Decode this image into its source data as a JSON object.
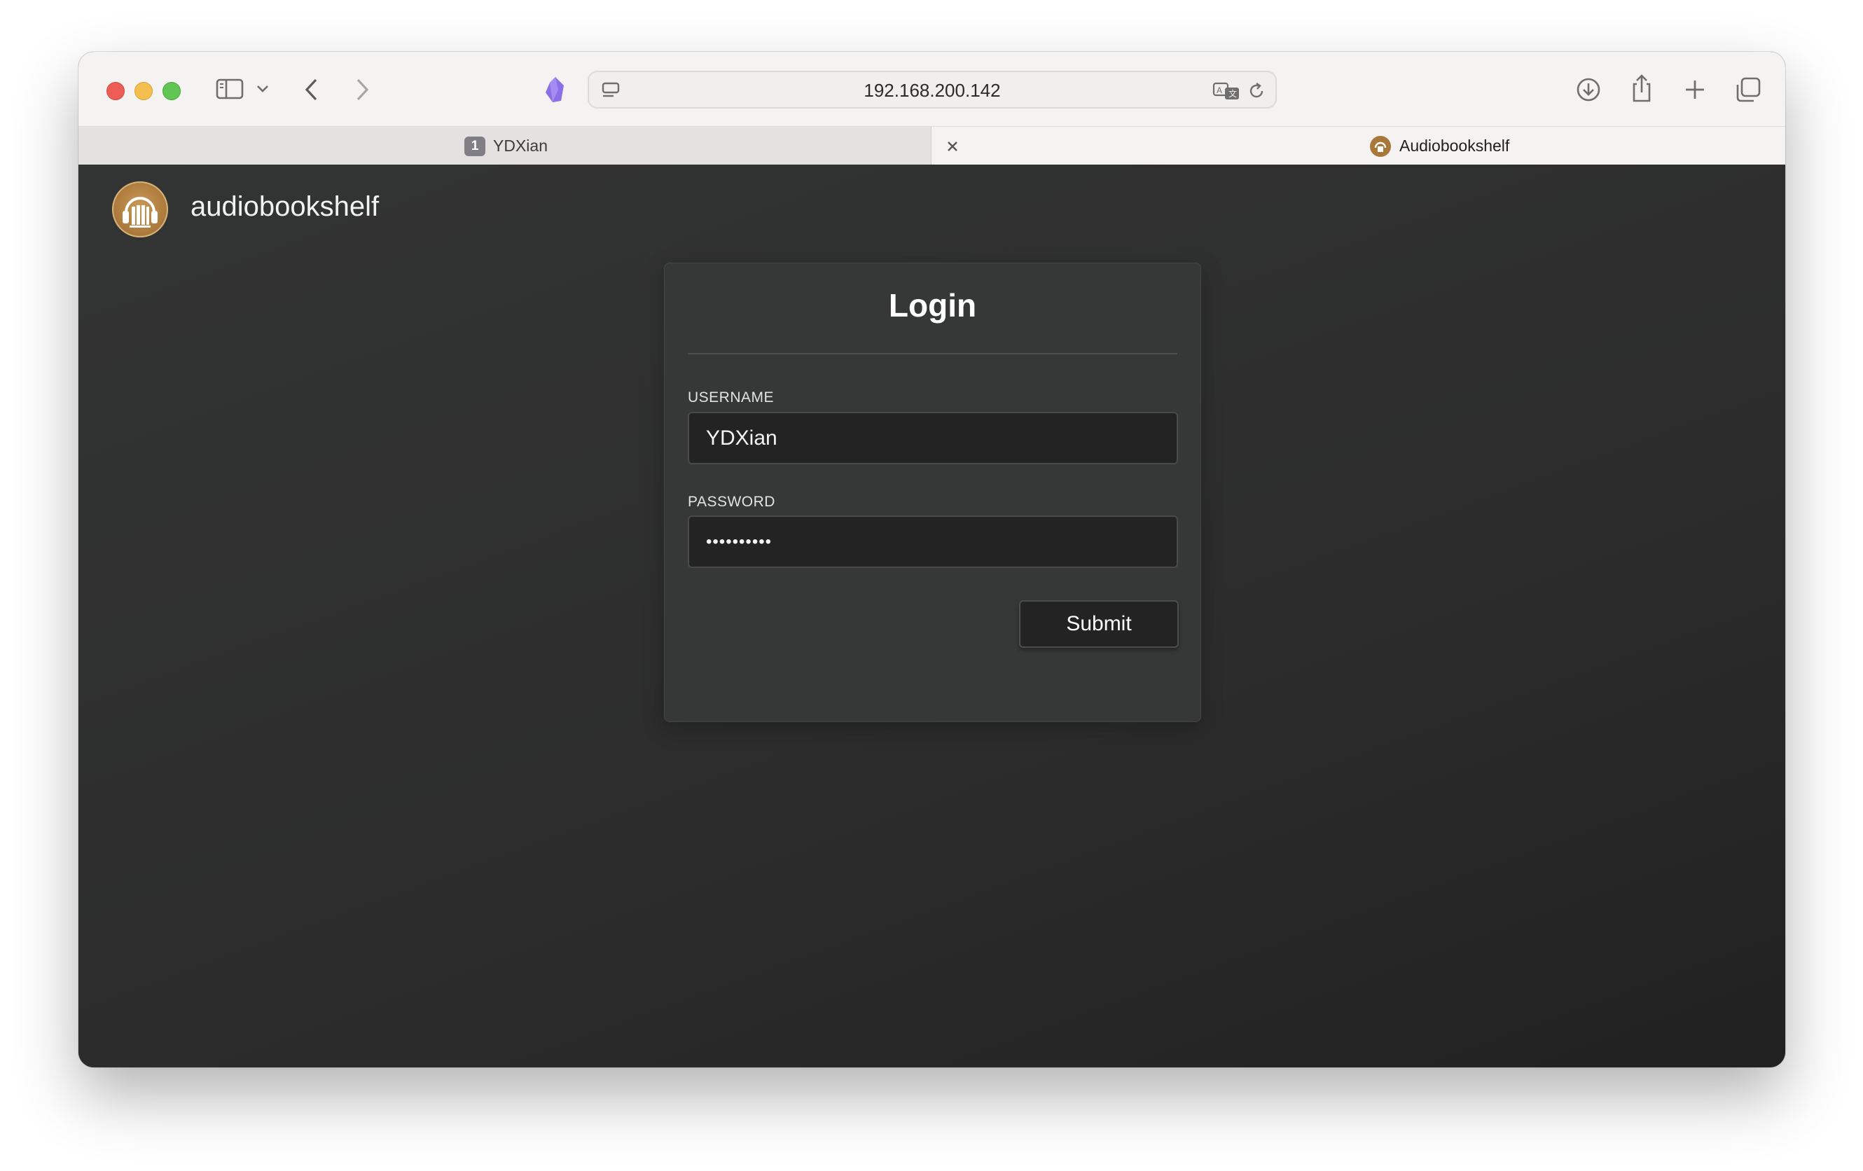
{
  "browser": {
    "url": "192.168.200.142",
    "tabs": [
      {
        "badge": "1",
        "label": "YDXian",
        "active": false
      },
      {
        "label": "Audiobookshelf",
        "active": true
      }
    ]
  },
  "app": {
    "name": "audiobookshelf"
  },
  "login": {
    "title": "Login",
    "username_label": "USERNAME",
    "username_value": "YDXian",
    "password_label": "PASSWORD",
    "password_value": "••••••••••",
    "submit_label": "Submit"
  },
  "colors": {
    "accent_logo": "#a9773a",
    "page_background": "#2f3030",
    "card_background": "#363737",
    "input_background": "#232323"
  }
}
